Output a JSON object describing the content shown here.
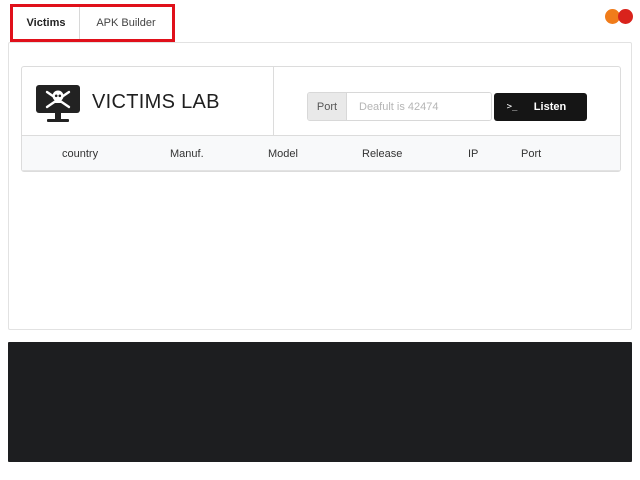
{
  "tabs": [
    {
      "label": "Victims",
      "active": true
    },
    {
      "label": "APK Builder",
      "active": false
    }
  ],
  "window_dots": {
    "colors": [
      "#f07c1a",
      "#d9231c"
    ]
  },
  "header": {
    "title": "VICTIMS LAB",
    "icon": "skull-monitor-icon"
  },
  "listener": {
    "port_label": "Port",
    "port_placeholder": "Deafult is 42474",
    "port_value": "",
    "listen_icon": ">_",
    "listen_label": "Listen"
  },
  "table": {
    "columns": [
      "country",
      "Manuf.",
      "Model",
      "Release",
      "IP",
      "Port"
    ],
    "rows": []
  },
  "console": {
    "lines": []
  },
  "colors": {
    "highlight": "#e0101a",
    "button": "#151515",
    "console_bg": "#1d1e20"
  }
}
